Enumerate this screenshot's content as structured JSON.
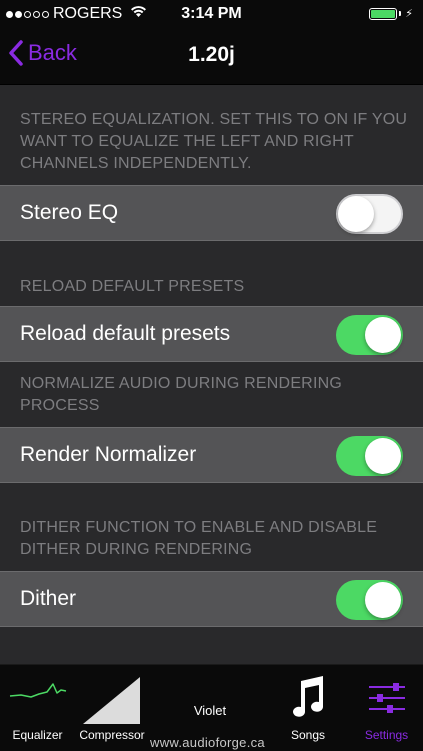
{
  "status_bar": {
    "carrier": "ROGERS",
    "time": "3:14 PM",
    "signal_dots_filled": 2,
    "signal_dots_total": 5,
    "battery_level": 1.0,
    "battery_color": "#4cd964"
  },
  "nav": {
    "back_label": "Back",
    "title": "1.20j",
    "accent_color": "#8a2be2"
  },
  "sections": [
    {
      "header": "STEREO EQUALIZATION. SET THIS TO ON IF YOU WANT TO EQUALIZE THE LEFT AND RIGHT CHANNELS INDEPENDENTLY.",
      "label": "Stereo EQ",
      "on": false
    },
    {
      "header": "RELOAD DEFAULT PRESETS",
      "label": "Reload default presets",
      "on": true
    },
    {
      "header": "NORMALIZE AUDIO DURING RENDERING PROCESS",
      "label": "Render Normalizer",
      "on": true
    },
    {
      "header": "DITHER FUNCTION TO ENABLE AND DISABLE DITHER DURING RENDERING",
      "label": "Dither",
      "on": true
    }
  ],
  "tabs": [
    {
      "label": "Equalizer",
      "icon": "equalizer-wave-icon",
      "active": false
    },
    {
      "label": "Compressor",
      "icon": "compressor-ramp-icon",
      "active": false
    },
    {
      "label": "Violet",
      "icon": "theme-text",
      "active": false
    },
    {
      "label": "Songs",
      "icon": "music-note-icon",
      "active": false
    },
    {
      "label": "Settings",
      "icon": "sliders-icon",
      "active": true
    }
  ],
  "footer_url": "www.audioforge.ca"
}
